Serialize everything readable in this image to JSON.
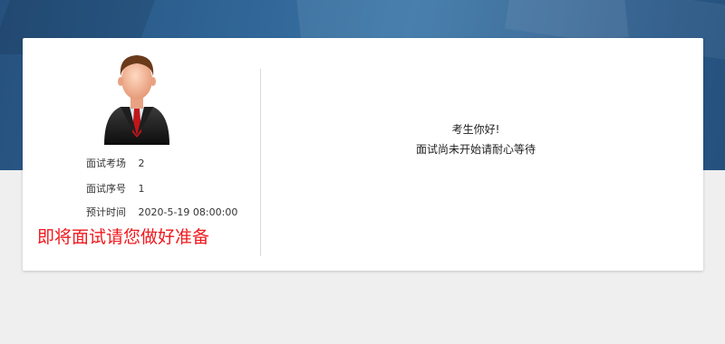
{
  "candidate": {
    "avatar_icon": "businessman-avatar-icon",
    "exam_room_label": "面试考场",
    "exam_room_value": "2",
    "sequence_label": "面试序号",
    "sequence_value": "1",
    "time_label": "预计时间",
    "time_value": "2020-5-19 08:00:00",
    "notice": "即将面试请您做好准备"
  },
  "status": {
    "greeting": "考生你好!",
    "message": "面试尚未开始请耐心等待"
  },
  "colors": {
    "banner": "#2f6495",
    "notice": "#f0191d",
    "background": "#efefef"
  }
}
